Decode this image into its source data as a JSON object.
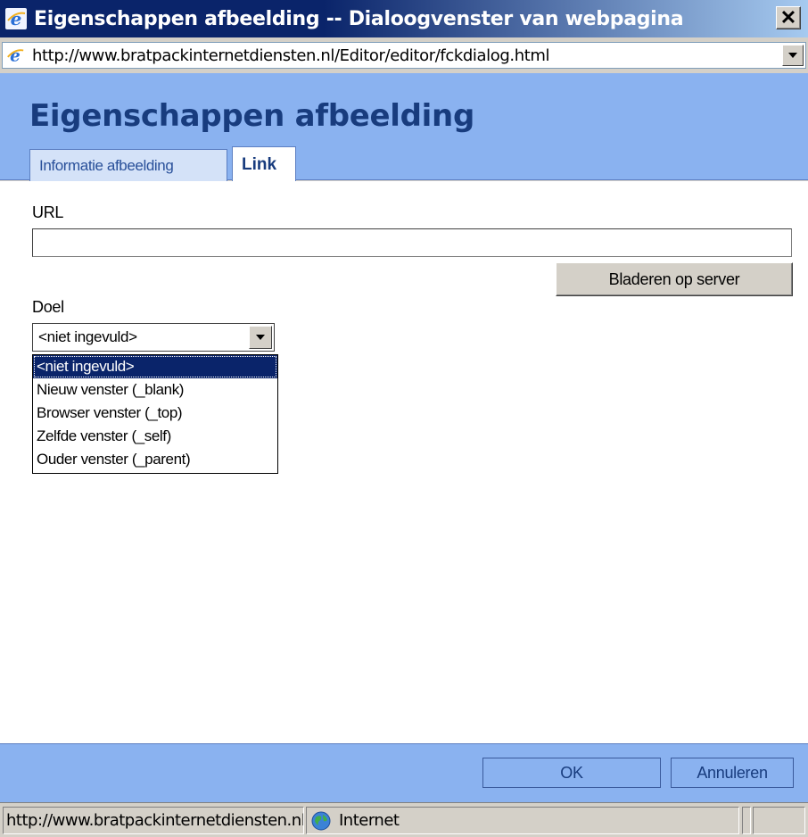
{
  "window": {
    "title": "Eigenschappen afbeelding -- Dialoogvenster van webpagina",
    "close_label": "✕",
    "address": "http://www.bratpackinternetdiensten.nl/Editor/editor/fckdialog.html"
  },
  "dialog": {
    "title": "Eigenschappen afbeelding",
    "tabs": [
      {
        "label": "Informatie afbeelding",
        "active": false
      },
      {
        "label": "Link",
        "active": true
      }
    ],
    "url_label": "URL",
    "url_value": "",
    "browse_label": "Bladeren op server",
    "target_label": "Doel",
    "target_selected": "<niet ingevuld>",
    "target_options": [
      "<niet ingevuld>",
      "Nieuw venster (_blank)",
      "Browser venster (_top)",
      "Zelfde venster (_self)",
      "Ouder venster (_parent)"
    ],
    "ok_label": "OK",
    "cancel_label": "Annuleren"
  },
  "statusbar": {
    "url": "http://www.bratpackinternetdiensten.nl/",
    "zone": "Internet"
  },
  "colors": {
    "header_bg": "#8ab2f0",
    "title_color": "#183c7e",
    "selection": "#0a246a"
  }
}
